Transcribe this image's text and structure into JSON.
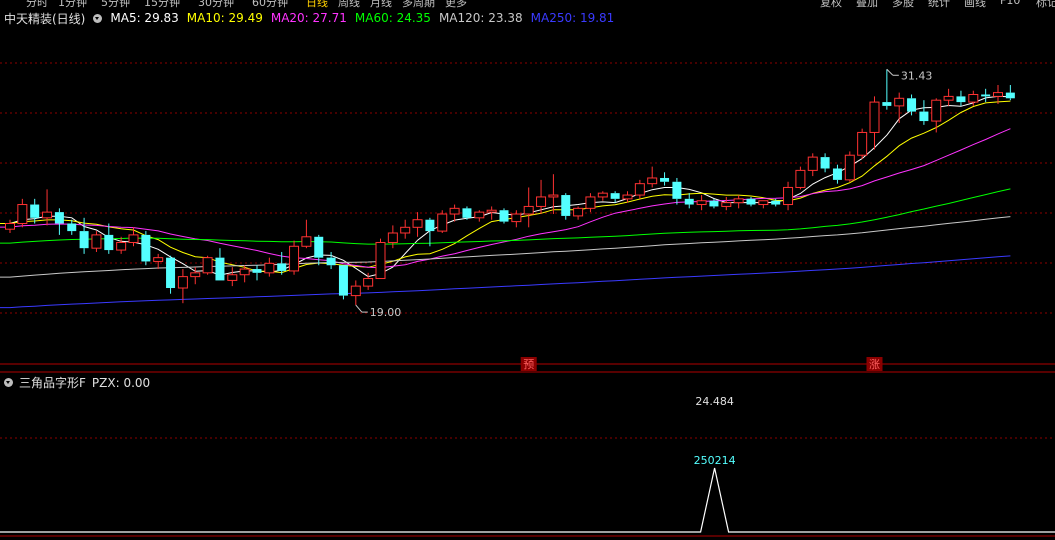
{
  "toolbar": {
    "left": [
      "分时",
      "1分钟",
      "5分钟",
      "15分钟",
      "30分钟",
      "60分钟",
      "日线",
      "周线",
      "月线",
      "多周期",
      "更多"
    ],
    "active": "日线",
    "right": [
      "复权",
      "叠加",
      "多股",
      "统计",
      "画线",
      "F10",
      "标记"
    ]
  },
  "legend": {
    "title": "中天精装(日线)",
    "items": [
      {
        "label": "MA5: 29.83",
        "color": "#ffffff"
      },
      {
        "label": "MA10: 29.49",
        "color": "#ffff00"
      },
      {
        "label": "MA20: 27.71",
        "color": "#ff33ff"
      },
      {
        "label": "MA60: 24.35",
        "color": "#00ff00"
      },
      {
        "label": "MA120: 23.38",
        "color": "#c8c8c8"
      },
      {
        "label": "MA250: 19.81",
        "color": "#3a3aff"
      }
    ]
  },
  "sub_legend": {
    "title": "三角品字形F",
    "value": "PZX: 0.00"
  },
  "colors": {
    "up": "#ff3232",
    "down": "#54ffff",
    "grid": "#8b0000",
    "marker_bg": "#8b0000",
    "marker_text": "#ff6060",
    "pzx_line": "#ffffff",
    "annot_text": "#c8c8c8",
    "date_label": "#54ffff"
  },
  "chart_data": [
    {
      "type": "candlestick",
      "title": "中天精装(日线)",
      "ylim": [
        16.0,
        33.5
      ],
      "ohlc": [
        [
          23.0,
          23.5,
          22.8,
          23.3
        ],
        [
          23.3,
          24.6,
          23.1,
          24.3
        ],
        [
          24.3,
          24.6,
          23.3,
          23.6
        ],
        [
          23.6,
          25.1,
          23.2,
          23.9
        ],
        [
          23.9,
          24.1,
          22.7,
          23.3
        ],
        [
          23.3,
          23.5,
          22.7,
          22.9
        ],
        [
          22.9,
          23.6,
          21.7,
          22.0
        ],
        [
          22.0,
          22.9,
          21.8,
          22.7
        ],
        [
          22.7,
          23.3,
          21.7,
          21.9
        ],
        [
          21.9,
          22.6,
          21.7,
          22.3
        ],
        [
          22.3,
          23.1,
          22.1,
          22.7
        ],
        [
          22.7,
          22.9,
          21.1,
          21.3
        ],
        [
          21.3,
          21.7,
          20.9,
          21.5
        ],
        [
          21.5,
          21.6,
          19.6,
          19.9
        ],
        [
          19.9,
          20.9,
          19.1,
          20.5
        ],
        [
          20.5,
          21.0,
          20.1,
          20.7
        ],
        [
          20.7,
          21.6,
          20.6,
          21.5
        ],
        [
          21.5,
          22.0,
          20.3,
          20.3
        ],
        [
          20.3,
          21.0,
          20.0,
          20.6
        ],
        [
          20.6,
          21.1,
          20.2,
          20.9
        ],
        [
          20.9,
          21.1,
          20.3,
          20.7
        ],
        [
          20.7,
          21.5,
          20.5,
          21.2
        ],
        [
          21.2,
          21.8,
          20.6,
          20.8
        ],
        [
          20.8,
          22.4,
          20.6,
          22.1
        ],
        [
          22.1,
          23.5,
          22.0,
          22.6
        ],
        [
          22.6,
          22.7,
          21.1,
          21.5
        ],
        [
          21.5,
          21.8,
          20.9,
          21.1
        ],
        [
          21.1,
          21.1,
          19.3,
          19.5
        ],
        [
          19.5,
          20.3,
          19.0,
          20.0
        ],
        [
          20.0,
          20.7,
          19.8,
          20.4
        ],
        [
          20.4,
          22.5,
          20.4,
          22.3
        ],
        [
          22.3,
          23.2,
          22.0,
          22.8
        ],
        [
          22.8,
          23.5,
          22.5,
          23.1
        ],
        [
          23.1,
          23.9,
          22.6,
          23.5
        ],
        [
          23.5,
          23.6,
          22.1,
          22.9
        ],
        [
          22.9,
          24.0,
          22.8,
          23.8
        ],
        [
          23.8,
          24.3,
          23.4,
          24.1
        ],
        [
          24.1,
          24.2,
          23.5,
          23.6
        ],
        [
          23.6,
          24.0,
          23.4,
          23.9
        ],
        [
          23.9,
          24.2,
          23.5,
          24.0
        ],
        [
          24.0,
          24.1,
          23.3,
          23.4
        ],
        [
          23.4,
          24.0,
          23.1,
          23.8
        ],
        [
          23.8,
          25.2,
          23.1,
          24.2
        ],
        [
          24.2,
          25.6,
          23.8,
          24.7
        ],
        [
          24.7,
          25.9,
          23.8,
          24.8
        ],
        [
          24.8,
          24.9,
          23.5,
          23.7
        ],
        [
          23.7,
          24.2,
          23.5,
          24.1
        ],
        [
          24.1,
          24.9,
          23.9,
          24.7
        ],
        [
          24.7,
          25.0,
          24.5,
          24.9
        ],
        [
          24.9,
          25.0,
          24.4,
          24.6
        ],
        [
          24.6,
          25.0,
          24.4,
          24.8
        ],
        [
          24.8,
          25.6,
          24.6,
          25.4
        ],
        [
          25.4,
          26.3,
          25.2,
          25.7
        ],
        [
          25.7,
          26.0,
          25.3,
          25.5
        ],
        [
          25.5,
          25.7,
          24.3,
          24.6
        ],
        [
          24.6,
          24.9,
          24.1,
          24.3
        ],
        [
          24.3,
          24.8,
          24.0,
          24.5
        ],
        [
          24.5,
          24.6,
          24.1,
          24.2
        ],
        [
          24.2,
          24.7,
          24.0,
          24.4
        ],
        [
          24.4,
          24.8,
          24.1,
          24.6
        ],
        [
          24.6,
          24.7,
          24.2,
          24.3
        ],
        [
          24.3,
          24.5,
          24.1,
          24.5
        ],
        [
          24.5,
          24.6,
          24.2,
          24.3
        ],
        [
          24.3,
          25.5,
          24.0,
          25.2
        ],
        [
          25.2,
          26.3,
          25.1,
          26.1
        ],
        [
          26.1,
          27.0,
          25.8,
          26.8
        ],
        [
          26.8,
          27.0,
          26.0,
          26.2
        ],
        [
          26.2,
          26.4,
          25.4,
          25.6
        ],
        [
          25.6,
          27.1,
          25.5,
          26.9
        ],
        [
          26.9,
          28.3,
          26.7,
          28.1
        ],
        [
          28.1,
          30.0,
          27.2,
          29.7
        ],
        [
          29.7,
          31.43,
          29.3,
          29.5
        ],
        [
          29.5,
          30.2,
          28.6,
          29.9
        ],
        [
          29.9,
          30.1,
          29.0,
          29.2
        ],
        [
          29.2,
          29.8,
          28.5,
          28.7
        ],
        [
          28.7,
          29.9,
          28.1,
          29.8
        ],
        [
          29.8,
          30.4,
          29.5,
          30.0
        ],
        [
          30.0,
          30.3,
          29.5,
          29.7
        ],
        [
          29.7,
          30.3,
          29.5,
          30.1
        ],
        [
          30.1,
          30.4,
          29.7,
          30.0
        ],
        [
          30.0,
          30.6,
          29.6,
          30.2
        ],
        [
          30.2,
          30.6,
          29.8,
          29.9
        ]
      ],
      "annotations": [
        {
          "label": "31.43",
          "candle": 71,
          "price": 31.43
        },
        {
          "label": "19.00",
          "candle": 28,
          "price": 19.0
        }
      ],
      "markers": [
        {
          "label": "预",
          "candle": 42
        },
        {
          "label": "涨",
          "candle": 70
        }
      ]
    },
    {
      "type": "line",
      "title": "三角品字形F",
      "series": [
        {
          "name": "PZX",
          "color": "#ffffff"
        }
      ],
      "peak": {
        "candle": 55,
        "value": 24.484,
        "date": "250214"
      },
      "ylim": [
        0,
        24.484
      ]
    }
  ]
}
